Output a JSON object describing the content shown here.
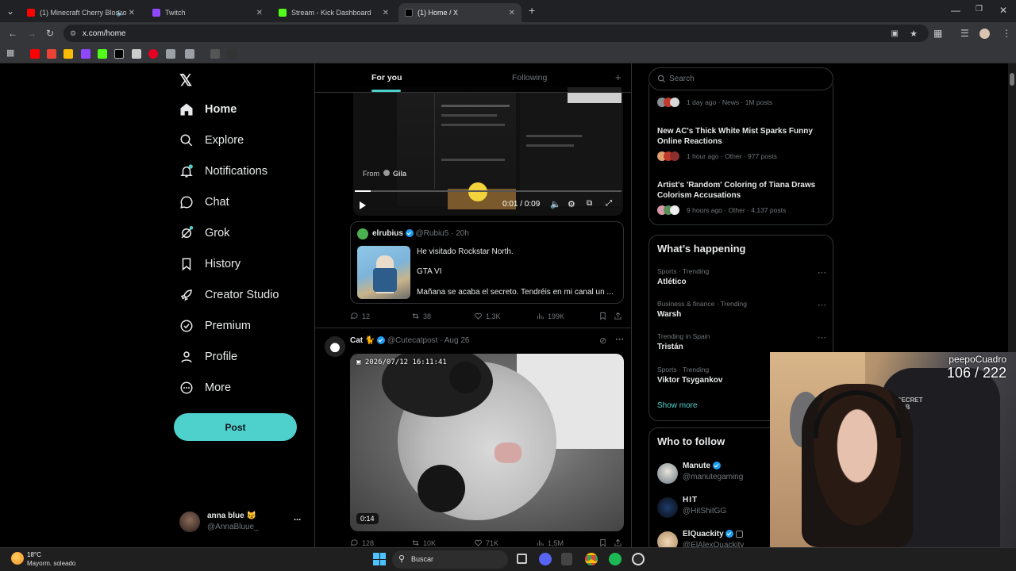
{
  "browser": {
    "tabs": [
      {
        "label": "(1) Minecraft Cherry Blosso",
        "color": "#ff0000"
      },
      {
        "label": "Twitch",
        "color": "#9146ff"
      },
      {
        "label": "Stream - Kick Dashboard",
        "color": "#53fc18"
      },
      {
        "label": "(1) Home / X",
        "color": "#ffffff"
      }
    ],
    "url": "x.com/home",
    "new_tab": "+"
  },
  "sidebar": {
    "items": [
      {
        "label": "Home",
        "icon": "home-icon"
      },
      {
        "label": "Explore",
        "icon": "search-icon"
      },
      {
        "label": "Notifications",
        "icon": "bell-icon"
      },
      {
        "label": "Chat",
        "icon": "chat-icon"
      },
      {
        "label": "Grok",
        "icon": "grok-icon"
      },
      {
        "label": "History",
        "icon": "bookmark-icon"
      },
      {
        "label": "Creator Studio",
        "icon": "rocket-icon"
      },
      {
        "label": "Premium",
        "icon": "verified-icon"
      },
      {
        "label": "Profile",
        "icon": "person-icon"
      },
      {
        "label": "More",
        "icon": "more-circle-icon"
      }
    ],
    "post_button": "Post",
    "account": {
      "name": "anna blue 😼",
      "handle": "@AnnaBluue_",
      "more": "..."
    }
  },
  "feed": {
    "tabs": {
      "for_you": "For you",
      "following": "Following",
      "plus": "+"
    },
    "video": {
      "from_label": "From",
      "from_name": "Gila",
      "time": "0:01 / 0:09"
    },
    "tweet1": {
      "name": "elrubius",
      "handle": "@Rubiu5",
      "time": "· 20h",
      "line1": "He visitado Rockstar North.",
      "line2": "GTA VI",
      "line3": "Mañana se acaba el secreto. Tendréis en mi canal un ...",
      "replies": "12",
      "retweets": "38",
      "likes": "1,3K",
      "views": "199K"
    },
    "tweet2": {
      "name": "Cat 🐈",
      "handle": "@Cutecatpost",
      "time": "· Aug 26",
      "timestamp_overlay": "2026/07/12  16:11:41",
      "duration": "0:14",
      "replies": "128",
      "retweets": "10K",
      "likes": "71K",
      "views": "1,5M"
    }
  },
  "right": {
    "search_placeholder": "Search",
    "news": [
      {
        "title": "",
        "meta": "1 day ago · News · 1M posts"
      },
      {
        "title": "New AC's Thick White Mist Sparks Funny Online Reactions",
        "meta": "1 hour ago · Other · 977 posts"
      },
      {
        "title": "Artist's 'Random' Coloring of Tiana Draws Colorism Accusations",
        "meta": "9 hours ago · Other · 4,137 posts"
      }
    ],
    "happening_title": "What’s happening",
    "trends": [
      {
        "cat": "Sports · Trending",
        "name": "Atlético"
      },
      {
        "cat": "Business & finance · Trending",
        "name": "Warsh"
      },
      {
        "cat": "Trending in Spain",
        "name": "Tristán"
      },
      {
        "cat": "Sports · Trending",
        "name": "Viktor Tsygankov"
      }
    ],
    "show_more": "Show more",
    "who_to_follow": "Who to follow",
    "follow": [
      {
        "name": "Manute",
        "handle": "@manutegaming"
      },
      {
        "name": "HIT",
        "handle": "@HitShitGG"
      },
      {
        "name": "ElQuackity",
        "handle": "@ElAlexQuackity"
      }
    ]
  },
  "overlay": {
    "label": "peepoCuadro",
    "count": "106 / 222"
  },
  "taskbar": {
    "weather_temp": "18°C",
    "weather_desc": "Mayorm. soleado",
    "search": "Buscar"
  }
}
